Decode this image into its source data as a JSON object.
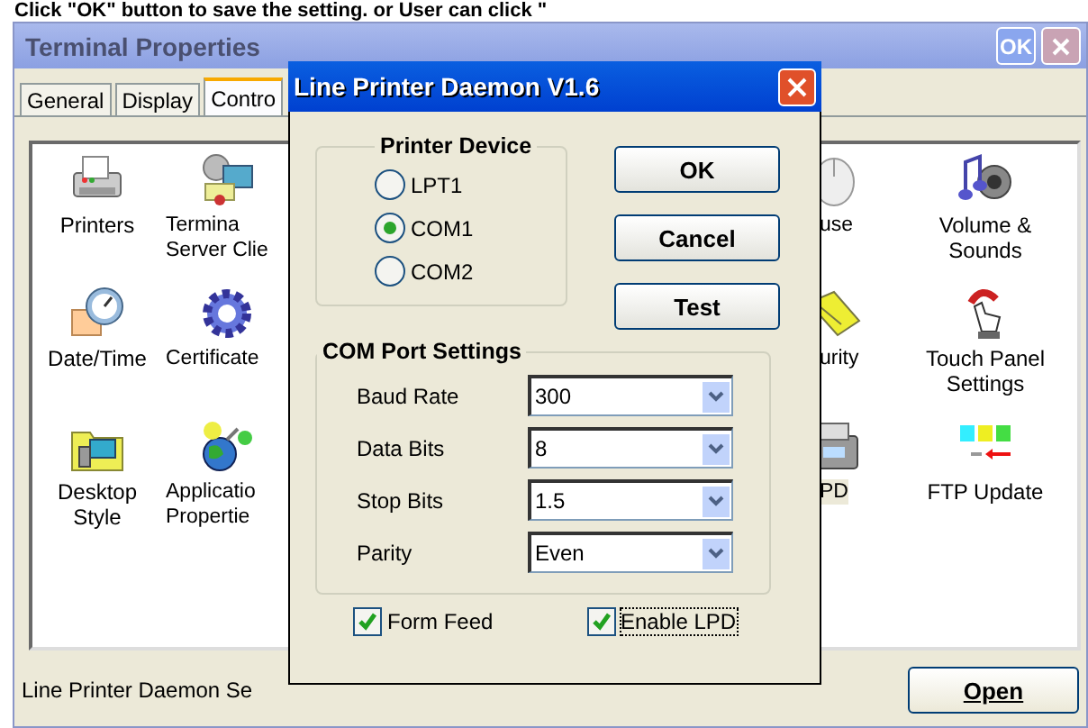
{
  "caption": "Click \"OK\" button to save the setting. or User can click \"",
  "window": {
    "title": "Terminal Properties",
    "ok_button": "OK"
  },
  "tabs": [
    {
      "label": "General",
      "selected": false
    },
    {
      "label": "Display",
      "selected": false
    },
    {
      "label": "Contro",
      "selected": true
    }
  ],
  "applet_rows": [
    [
      {
        "kind": "printer",
        "label": "Printers",
        "selected": false
      },
      {
        "kind": "network",
        "label": "Termina\nServer Clie",
        "selected": false
      },
      {
        "kind": "mouse",
        "label": "use",
        "selected": false
      },
      {
        "kind": "sound",
        "label": "Volume &\nSounds",
        "selected": false
      }
    ],
    [
      {
        "kind": "clock",
        "label": "Date/Time",
        "selected": false
      },
      {
        "kind": "gear",
        "label": "Certificate",
        "selected": false
      },
      {
        "kind": "tag",
        "label": "urity",
        "selected": false
      },
      {
        "kind": "touch",
        "label": "Touch Panel\nSettings",
        "selected": false
      }
    ],
    [
      {
        "kind": "folder",
        "label": "Desktop\nStyle",
        "selected": false
      },
      {
        "kind": "globe",
        "label": "Applicatio\nPropertie",
        "selected": false
      },
      {
        "kind": "lpd",
        "label": "PD",
        "selected": true
      },
      {
        "kind": "ftp",
        "label": "FTP Update",
        "selected": false
      }
    ]
  ],
  "description": "Line Printer Daemon Se",
  "open_button": "Open",
  "dialog": {
    "title": "Line Printer Daemon V1.6",
    "printer_device": {
      "title": "Printer Device",
      "options": [
        {
          "label": "LPT1",
          "selected": false
        },
        {
          "label": "COM1",
          "selected": true
        },
        {
          "label": "COM2",
          "selected": false
        }
      ]
    },
    "buttons": [
      "OK",
      "Cancel",
      "Test"
    ],
    "com_port": {
      "title": "COM Port Settings",
      "fields": [
        {
          "label": "Baud Rate",
          "value": "300"
        },
        {
          "label": "Data Bits",
          "value": "8"
        },
        {
          "label": "Stop Bits",
          "value": "1.5"
        },
        {
          "label": "Parity",
          "value": "Even"
        }
      ]
    },
    "options": [
      {
        "label": "Form Feed",
        "checked": true,
        "focused": false
      },
      {
        "label": "Enable LPD",
        "checked": true,
        "focused": true
      }
    ]
  }
}
